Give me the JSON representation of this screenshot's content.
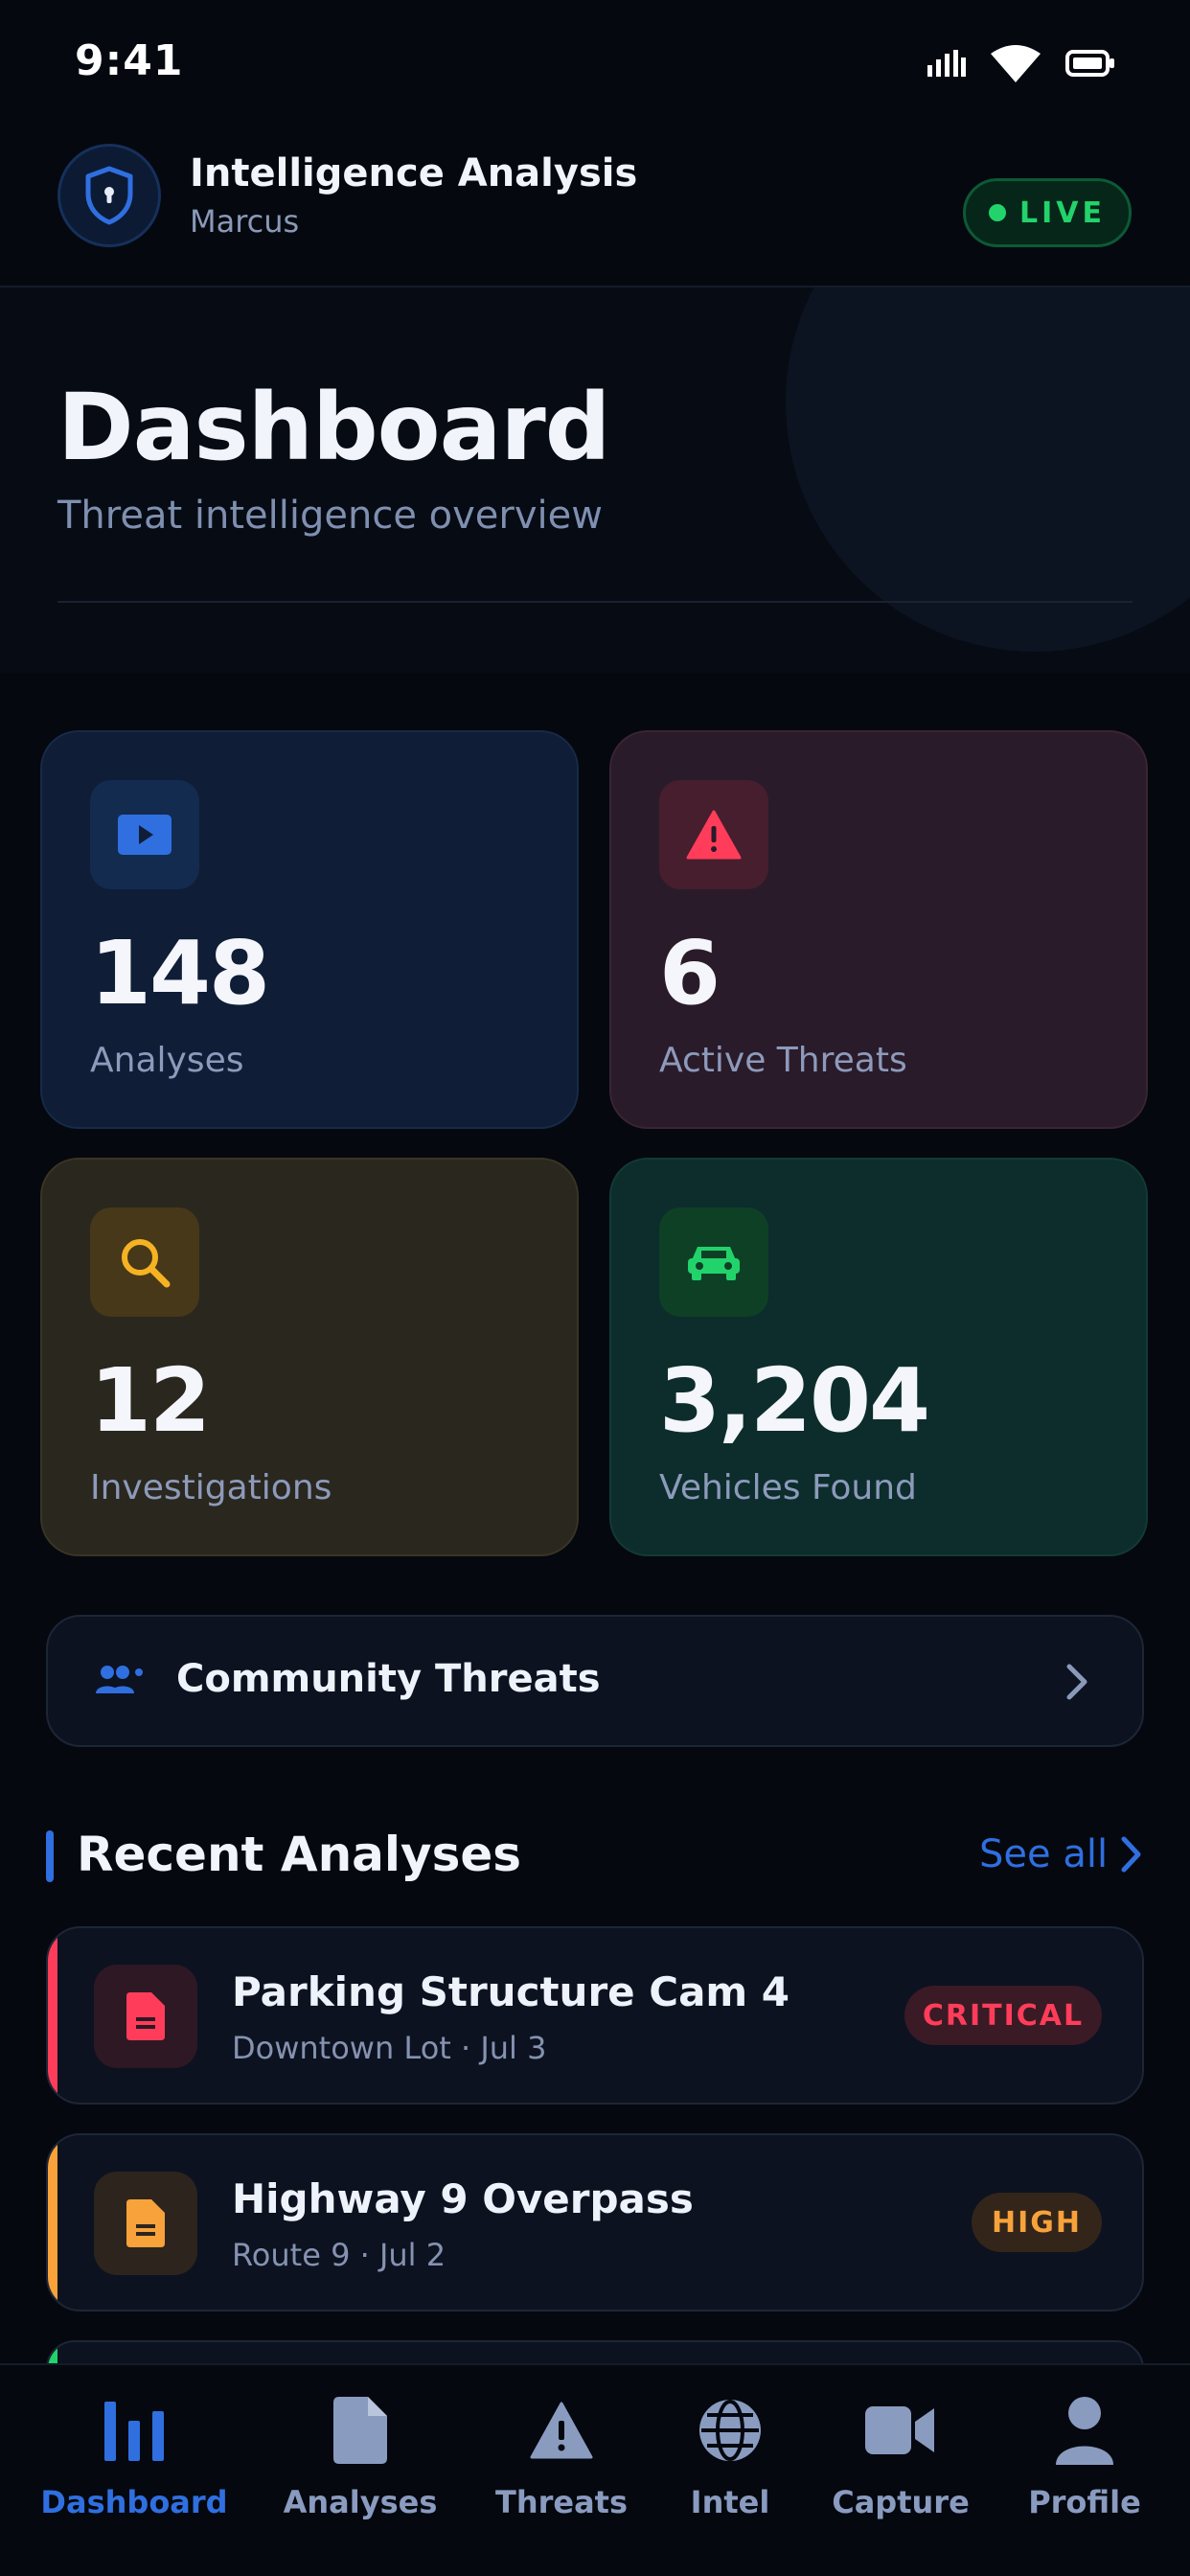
{
  "status_bar": {
    "time": "9:41"
  },
  "header": {
    "title": "Intelligence Analysis",
    "user": "Marcus",
    "live_label": "LIVE"
  },
  "hero": {
    "title": "Dashboard",
    "subtitle": "Threat intelligence overview"
  },
  "stats": [
    {
      "value": "148",
      "label": "Analyses",
      "icon": "video-play-icon",
      "accent": "#2f6fe0"
    },
    {
      "value": "6",
      "label": "Active Threats",
      "icon": "warning-icon",
      "accent": "#ff3d5a"
    },
    {
      "value": "12",
      "label": "Investigations",
      "icon": "search-icon",
      "accent": "#f5b323"
    },
    {
      "value": "3,204",
      "label": "Vehicles Found",
      "icon": "car-icon",
      "accent": "#22d36b"
    }
  ],
  "community": {
    "label": "Community Threats",
    "icon": "users-icon"
  },
  "recent": {
    "title": "Recent Analyses",
    "see_all": "See all",
    "items": [
      {
        "title": "Parking Structure Cam 4",
        "subtitle": "Downtown Lot · Jul 3",
        "severity": "CRITICAL",
        "color": "#ff3d5a"
      },
      {
        "title": "Highway 9 Overpass",
        "subtitle": "Route 9 · Jul 2",
        "severity": "HIGH",
        "color": "#f7a23a"
      }
    ]
  },
  "tabs": [
    {
      "label": "Dashboard",
      "icon": "bar-chart-icon",
      "active": true
    },
    {
      "label": "Analyses",
      "icon": "document-icon",
      "active": false
    },
    {
      "label": "Threats",
      "icon": "warning-icon",
      "active": false
    },
    {
      "label": "Intel",
      "icon": "globe-icon",
      "active": false
    },
    {
      "label": "Capture",
      "icon": "video-camera-icon",
      "active": false
    },
    {
      "label": "Profile",
      "icon": "person-icon",
      "active": false
    }
  ],
  "colors": {
    "primary": "#2f6fe0",
    "live": "#22d36b",
    "critical": "#ff3d5a",
    "high": "#f7a23a"
  }
}
